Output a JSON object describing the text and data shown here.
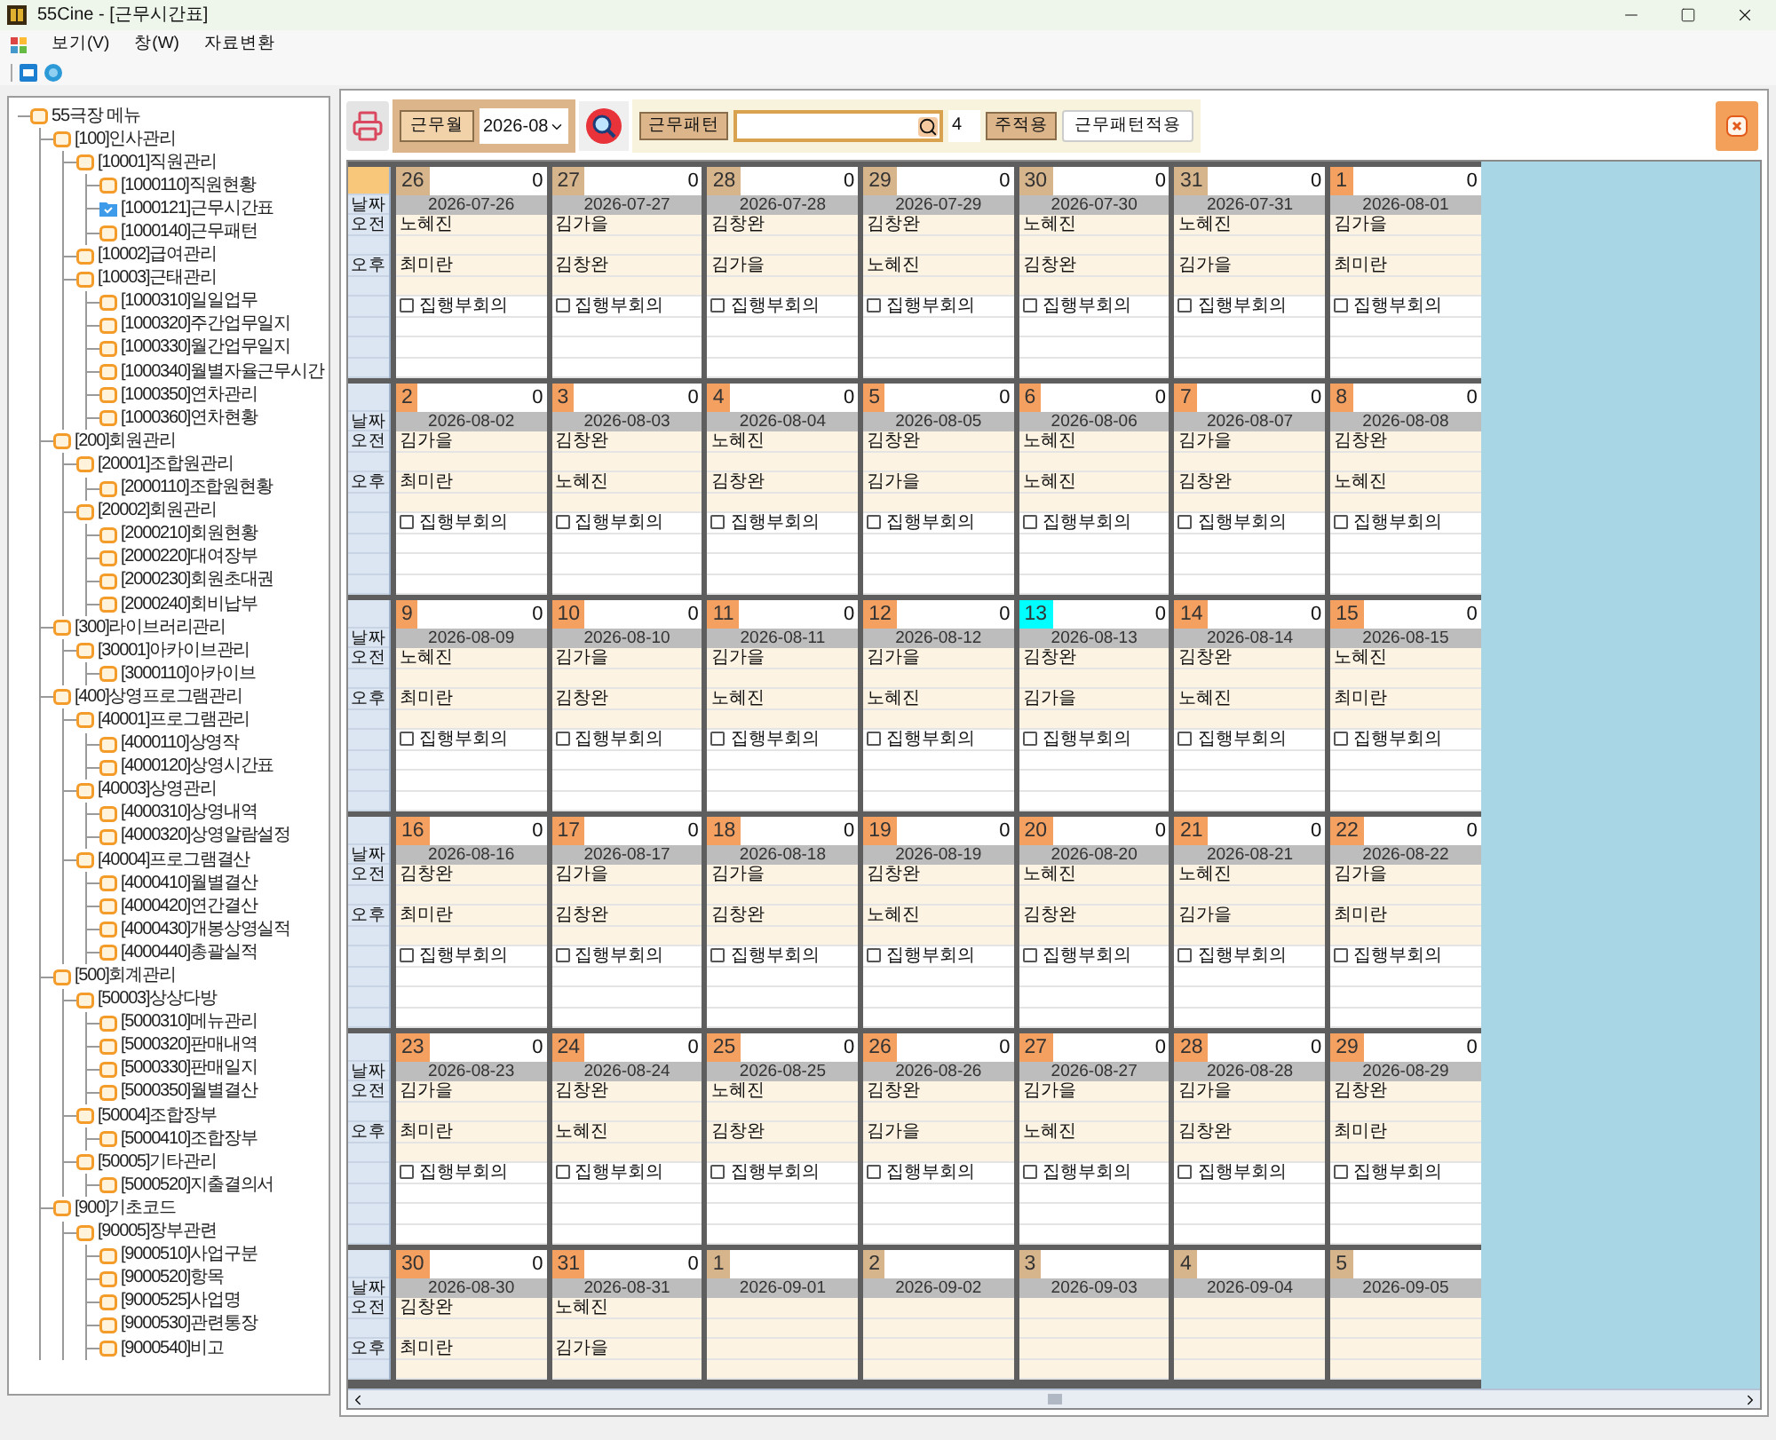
{
  "window": {
    "title": "55Cine - [근무시간표]"
  },
  "menu": [
    "보기(V)",
    "창(W)",
    "자료변환"
  ],
  "tree": {
    "label": "55극장 메뉴",
    "selected": false,
    "children": [
      {
        "label": "[100]인사관리",
        "selected": false,
        "children": [
          {
            "label": "[10001]직원관리",
            "selected": false,
            "children": [
              {
                "label": "[1000110]직원현황",
                "selected": false
              },
              {
                "label": "[1000121]근무시간표",
                "selected": true
              },
              {
                "label": "[1000140]근무패턴",
                "selected": false
              }
            ]
          },
          {
            "label": "[10002]급여관리",
            "selected": false
          },
          {
            "label": "[10003]근태관리",
            "selected": false,
            "children": [
              {
                "label": "[1000310]일일업무",
                "selected": false
              },
              {
                "label": "[1000320]주간업무일지",
                "selected": false
              },
              {
                "label": "[1000330]월간업무일지",
                "selected": false
              },
              {
                "label": "[1000340]월별자율근무시간",
                "selected": false
              },
              {
                "label": "[1000350]연차관리",
                "selected": false
              },
              {
                "label": "[1000360]연차현황",
                "selected": false
              }
            ]
          }
        ]
      },
      {
        "label": "[200]회원관리",
        "selected": false,
        "children": [
          {
            "label": "[20001]조합원관리",
            "selected": false,
            "children": [
              {
                "label": "[2000110]조합원현황",
                "selected": false
              }
            ]
          },
          {
            "label": "[20002]회원관리",
            "selected": false,
            "children": [
              {
                "label": "[2000210]회원현황",
                "selected": false
              },
              {
                "label": "[2000220]대여장부",
                "selected": false
              },
              {
                "label": "[2000230]회원초대권",
                "selected": false
              },
              {
                "label": "[2000240]회비납부",
                "selected": false
              }
            ]
          }
        ]
      },
      {
        "label": "[300]라이브러리관리",
        "selected": false,
        "children": [
          {
            "label": "[30001]아카이브관리",
            "selected": false,
            "children": [
              {
                "label": "[3000110]아카이브",
                "selected": false
              }
            ]
          }
        ]
      },
      {
        "label": "[400]상영프로그램관리",
        "selected": false,
        "children": [
          {
            "label": "[40001]프로그램관리",
            "selected": false,
            "children": [
              {
                "label": "[4000110]상영작",
                "selected": false
              },
              {
                "label": "[4000120]상영시간표",
                "selected": false
              }
            ]
          },
          {
            "label": "[40003]상영관리",
            "selected": false,
            "children": [
              {
                "label": "[4000310]상영내역",
                "selected": false
              },
              {
                "label": "[4000320]상영알람설정",
                "selected": false
              }
            ]
          },
          {
            "label": "[40004]프로그램결산",
            "selected": false,
            "children": [
              {
                "label": "[4000410]월별결산",
                "selected": false
              },
              {
                "label": "[4000420]연간결산",
                "selected": false
              },
              {
                "label": "[4000430]개봉상영실적",
                "selected": false
              },
              {
                "label": "[4000440]총괄실적",
                "selected": false
              }
            ]
          }
        ]
      },
      {
        "label": "[500]회계관리",
        "selected": false,
        "children": [
          {
            "label": "[50003]상상다방",
            "selected": false,
            "children": [
              {
                "label": "[5000310]메뉴관리",
                "selected": false
              },
              {
                "label": "[5000320]판매내역",
                "selected": false
              },
              {
                "label": "[5000330]판매일지",
                "selected": false
              },
              {
                "label": "[5000350]월별결산",
                "selected": false
              }
            ]
          },
          {
            "label": "[50004]조합장부",
            "selected": false,
            "children": [
              {
                "label": "[5000410]조합장부",
                "selected": false
              }
            ]
          },
          {
            "label": "[50005]기타관리",
            "selected": false,
            "children": [
              {
                "label": "[5000520]지출결의서",
                "selected": false
              }
            ]
          }
        ]
      },
      {
        "label": "[900]기초코드",
        "selected": false,
        "children": [
          {
            "label": "[90005]장부관련",
            "selected": false,
            "children": [
              {
                "label": "[9000510]사업구분",
                "selected": false
              },
              {
                "label": "[9000520]항목",
                "selected": false
              },
              {
                "label": "[9000525]사업명",
                "selected": false
              },
              {
                "label": "[9000530]관련통장",
                "selected": false
              },
              {
                "label": "[9000540]비고",
                "selected": false
              }
            ]
          }
        ]
      }
    ]
  },
  "toolbar": {
    "month_label": "근무월",
    "month": "2026-08",
    "pattern_label": "근무패턴",
    "weeks_value": "4",
    "apply_week": "주적용",
    "apply_pattern": "근무패턴적용"
  },
  "weeks": [
    {
      "selected": true,
      "labels": [
        "날짜",
        "오전",
        "오후"
      ],
      "days": [
        {
          "day": "26",
          "count": "0",
          "date": "2026-07-26",
          "color": "#d6b48c",
          "am": "노혜진",
          "pm": "최미란",
          "meeting": {
            "label": "집행부회의",
            "checked": false
          }
        },
        {
          "day": "27",
          "count": "0",
          "date": "2026-07-27",
          "color": "#d6b48c",
          "am": "김가을",
          "pm": "김창완",
          "meeting": {
            "label": "집행부회의",
            "checked": false
          }
        },
        {
          "day": "28",
          "count": "0",
          "date": "2026-07-28",
          "color": "#d6b48c",
          "am": "김창완",
          "pm": "김가을",
          "meeting": {
            "label": "집행부회의",
            "checked": false
          }
        },
        {
          "day": "29",
          "count": "0",
          "date": "2026-07-29",
          "color": "#d6b48c",
          "am": "김창완",
          "pm": "노혜진",
          "meeting": {
            "label": "집행부회의",
            "checked": false
          }
        },
        {
          "day": "30",
          "count": "0",
          "date": "2026-07-30",
          "color": "#d6b48c",
          "am": "노혜진",
          "pm": "김창완",
          "meeting": {
            "label": "집행부회의",
            "checked": false
          }
        },
        {
          "day": "31",
          "count": "0",
          "date": "2026-07-31",
          "color": "#d6b48c",
          "am": "노혜진",
          "pm": "김가을",
          "meeting": {
            "label": "집행부회의",
            "checked": false
          }
        },
        {
          "day": "1",
          "count": "0",
          "date": "2026-08-01",
          "color": "#f4a060",
          "am": "김가을",
          "pm": "최미란",
          "meeting": {
            "label": "집행부회의",
            "checked": false
          }
        }
      ]
    },
    {
      "selected": false,
      "labels": [
        "날짜",
        "오전",
        "오후"
      ],
      "days": [
        {
          "day": "2",
          "count": "0",
          "date": "2026-08-02",
          "color": "#f4a060",
          "am": "김가을",
          "pm": "최미란",
          "meeting": {
            "label": "집행부회의",
            "checked": false
          }
        },
        {
          "day": "3",
          "count": "0",
          "date": "2026-08-03",
          "color": "#f4a060",
          "am": "김창완",
          "pm": "노혜진",
          "meeting": {
            "label": "집행부회의",
            "checked": false
          }
        },
        {
          "day": "4",
          "count": "0",
          "date": "2026-08-04",
          "color": "#f4a060",
          "am": "노혜진",
          "pm": "김창완",
          "meeting": {
            "label": "집행부회의",
            "checked": false
          }
        },
        {
          "day": "5",
          "count": "0",
          "date": "2026-08-05",
          "color": "#f4a060",
          "am": "김창완",
          "pm": "김가을",
          "meeting": {
            "label": "집행부회의",
            "checked": false
          }
        },
        {
          "day": "6",
          "count": "0",
          "date": "2026-08-06",
          "color": "#f4a060",
          "am": "노혜진",
          "pm": "노혜진",
          "meeting": {
            "label": "집행부회의",
            "checked": false
          }
        },
        {
          "day": "7",
          "count": "0",
          "date": "2026-08-07",
          "color": "#f4a060",
          "am": "김가을",
          "pm": "김창완",
          "meeting": {
            "label": "집행부회의",
            "checked": false
          }
        },
        {
          "day": "8",
          "count": "0",
          "date": "2026-08-08",
          "color": "#f4a060",
          "am": "김창완",
          "pm": "노혜진",
          "meeting": {
            "label": "집행부회의",
            "checked": false
          }
        }
      ]
    },
    {
      "selected": false,
      "labels": [
        "날짜",
        "오전",
        "오후"
      ],
      "days": [
        {
          "day": "9",
          "count": "0",
          "date": "2026-08-09",
          "color": "#f4a060",
          "am": "노혜진",
          "pm": "최미란",
          "meeting": {
            "label": "집행부회의",
            "checked": false
          }
        },
        {
          "day": "10",
          "count": "0",
          "date": "2026-08-10",
          "color": "#f4a060",
          "am": "김가을",
          "pm": "김창완",
          "meeting": {
            "label": "집행부회의",
            "checked": false
          }
        },
        {
          "day": "11",
          "count": "0",
          "date": "2026-08-11",
          "color": "#f4a060",
          "am": "김가을",
          "pm": "노혜진",
          "meeting": {
            "label": "집행부회의",
            "checked": false
          }
        },
        {
          "day": "12",
          "count": "0",
          "date": "2026-08-12",
          "color": "#f4a060",
          "am": "김가을",
          "pm": "노혜진",
          "meeting": {
            "label": "집행부회의",
            "checked": false
          }
        },
        {
          "day": "13",
          "count": "0",
          "date": "2026-08-13",
          "color": "#00ffff",
          "am": "김창완",
          "pm": "김가을",
          "meeting": {
            "label": "집행부회의",
            "checked": false
          }
        },
        {
          "day": "14",
          "count": "0",
          "date": "2026-08-14",
          "color": "#f4a060",
          "am": "김창완",
          "pm": "노혜진",
          "meeting": {
            "label": "집행부회의",
            "checked": false
          }
        },
        {
          "day": "15",
          "count": "0",
          "date": "2026-08-15",
          "color": "#f4a060",
          "am": "노혜진",
          "pm": "최미란",
          "meeting": {
            "label": "집행부회의",
            "checked": false
          }
        }
      ]
    },
    {
      "selected": false,
      "labels": [
        "날짜",
        "오전",
        "오후"
      ],
      "days": [
        {
          "day": "16",
          "count": "0",
          "date": "2026-08-16",
          "color": "#f4a060",
          "am": "김창완",
          "pm": "최미란",
          "meeting": {
            "label": "집행부회의",
            "checked": false
          }
        },
        {
          "day": "17",
          "count": "0",
          "date": "2026-08-17",
          "color": "#f4a060",
          "am": "김가을",
          "pm": "김창완",
          "meeting": {
            "label": "집행부회의",
            "checked": false
          }
        },
        {
          "day": "18",
          "count": "0",
          "date": "2026-08-18",
          "color": "#f4a060",
          "am": "김가을",
          "pm": "김창완",
          "meeting": {
            "label": "집행부회의",
            "checked": false
          }
        },
        {
          "day": "19",
          "count": "0",
          "date": "2026-08-19",
          "color": "#f4a060",
          "am": "김창완",
          "pm": "노혜진",
          "meeting": {
            "label": "집행부회의",
            "checked": false
          }
        },
        {
          "day": "20",
          "count": "0",
          "date": "2026-08-20",
          "color": "#f4a060",
          "am": "노혜진",
          "pm": "김창완",
          "meeting": {
            "label": "집행부회의",
            "checked": false
          }
        },
        {
          "day": "21",
          "count": "0",
          "date": "2026-08-21",
          "color": "#f4a060",
          "am": "노혜진",
          "pm": "김가을",
          "meeting": {
            "label": "집행부회의",
            "checked": false
          }
        },
        {
          "day": "22",
          "count": "0",
          "date": "2026-08-22",
          "color": "#f4a060",
          "am": "김가을",
          "pm": "최미란",
          "meeting": {
            "label": "집행부회의",
            "checked": false
          }
        }
      ]
    },
    {
      "selected": false,
      "labels": [
        "날짜",
        "오전",
        "오후"
      ],
      "days": [
        {
          "day": "23",
          "count": "0",
          "date": "2026-08-23",
          "color": "#f4a060",
          "am": "김가을",
          "pm": "최미란",
          "meeting": {
            "label": "집행부회의",
            "checked": false
          }
        },
        {
          "day": "24",
          "count": "0",
          "date": "2026-08-24",
          "color": "#f4a060",
          "am": "김창완",
          "pm": "노혜진",
          "meeting": {
            "label": "집행부회의",
            "checked": false
          }
        },
        {
          "day": "25",
          "count": "0",
          "date": "2026-08-25",
          "color": "#f4a060",
          "am": "노혜진",
          "pm": "김창완",
          "meeting": {
            "label": "집행부회의",
            "checked": false
          }
        },
        {
          "day": "26",
          "count": "0",
          "date": "2026-08-26",
          "color": "#f4a060",
          "am": "김창완",
          "pm": "김가을",
          "meeting": {
            "label": "집행부회의",
            "checked": false
          }
        },
        {
          "day": "27",
          "count": "0",
          "date": "2026-08-27",
          "color": "#f4a060",
          "am": "김가을",
          "pm": "노혜진",
          "meeting": {
            "label": "집행부회의",
            "checked": false
          }
        },
        {
          "day": "28",
          "count": "0",
          "date": "2026-08-28",
          "color": "#f4a060",
          "am": "김가을",
          "pm": "김창완",
          "meeting": {
            "label": "집행부회의",
            "checked": false
          }
        },
        {
          "day": "29",
          "count": "0",
          "date": "2026-08-29",
          "color": "#f4a060",
          "am": "김창완",
          "pm": "최미란",
          "meeting": {
            "label": "집행부회의",
            "checked": false
          }
        }
      ]
    },
    {
      "selected": false,
      "labels": [
        "날짜",
        "오전",
        "오후"
      ],
      "days": [
        {
          "day": "30",
          "count": "0",
          "date": "2026-08-30",
          "color": "#f4a060",
          "am": "김창완",
          "pm": "최미란"
        },
        {
          "day": "31",
          "count": "0",
          "date": "2026-08-31",
          "color": "#f4a060",
          "am": "노혜진",
          "pm": "김가을"
        },
        {
          "day": "1",
          "date": "2026-09-01",
          "color": "#d6b48c"
        },
        {
          "day": "2",
          "date": "2026-09-02",
          "color": "#d6b48c"
        },
        {
          "day": "3",
          "date": "2026-09-03",
          "color": "#d6b48c"
        },
        {
          "day": "4",
          "date": "2026-09-04",
          "color": "#d6b48c"
        },
        {
          "day": "5",
          "date": "2026-09-05",
          "color": "#d6b48c"
        }
      ]
    }
  ]
}
